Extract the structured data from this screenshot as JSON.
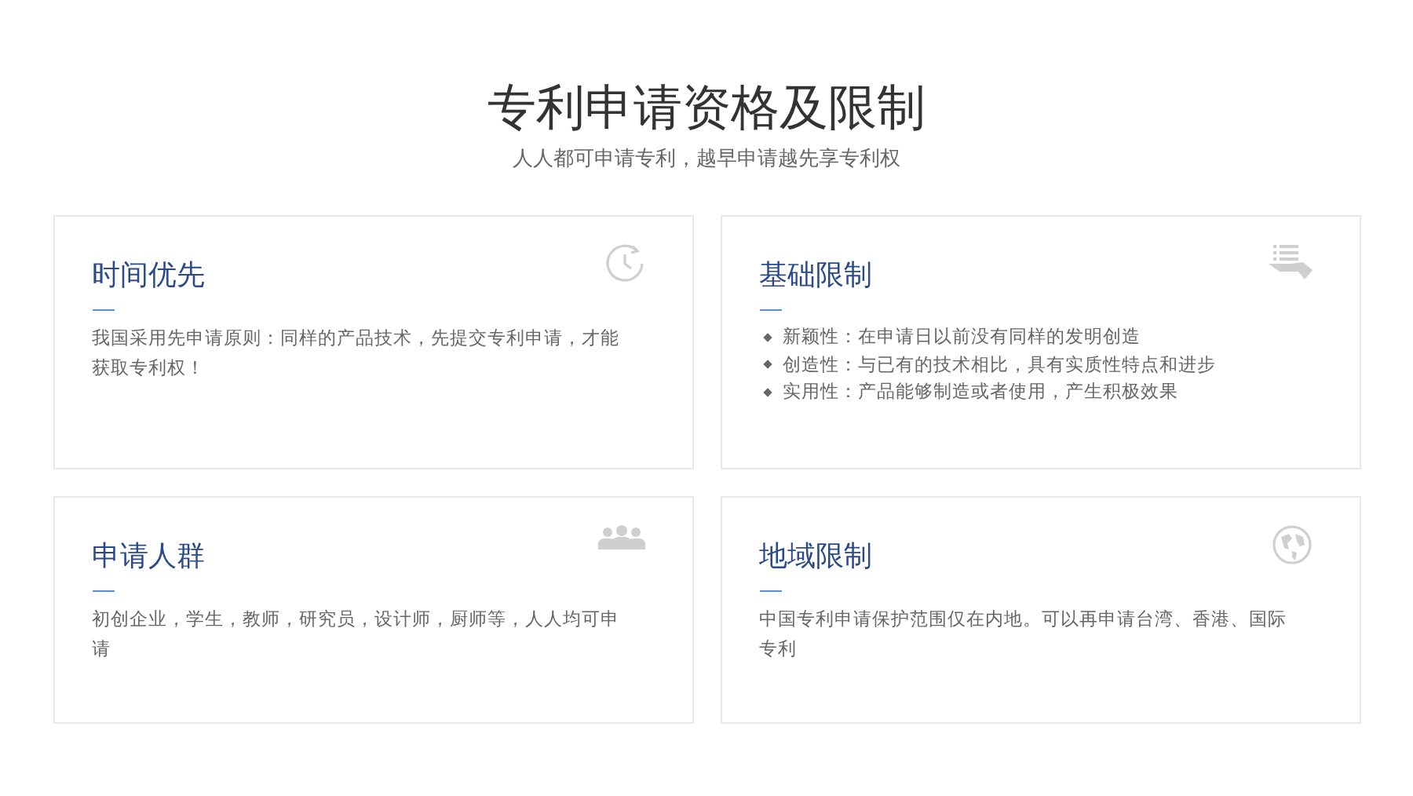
{
  "header": {
    "title": "专利申请资格及限制",
    "subtitle": "人人都可申请专利，越早申请越先享专利权"
  },
  "cards": [
    {
      "title": "时间优先",
      "kind": "text",
      "text": "我国采用先申请原则：同样的产品技术，先提交专利申请，才能获取专利权！"
    },
    {
      "title": "基础限制",
      "kind": "list",
      "items": [
        "新颖性：在申请日以前没有同样的发明创造",
        "创造性：与已有的技术相比，具有实质性特点和进步",
        "实用性：产品能够制造或者使用，产生积极效果"
      ]
    },
    {
      "title": "申请人群",
      "kind": "text",
      "text": "初创企业，学生，教师，研究员，设计师，厨师等，人人均可申请"
    },
    {
      "title": "地域限制",
      "kind": "text",
      "text": "中国专利申请保护范围仅在内地。可以再申请台湾、香港、国际专利"
    }
  ]
}
